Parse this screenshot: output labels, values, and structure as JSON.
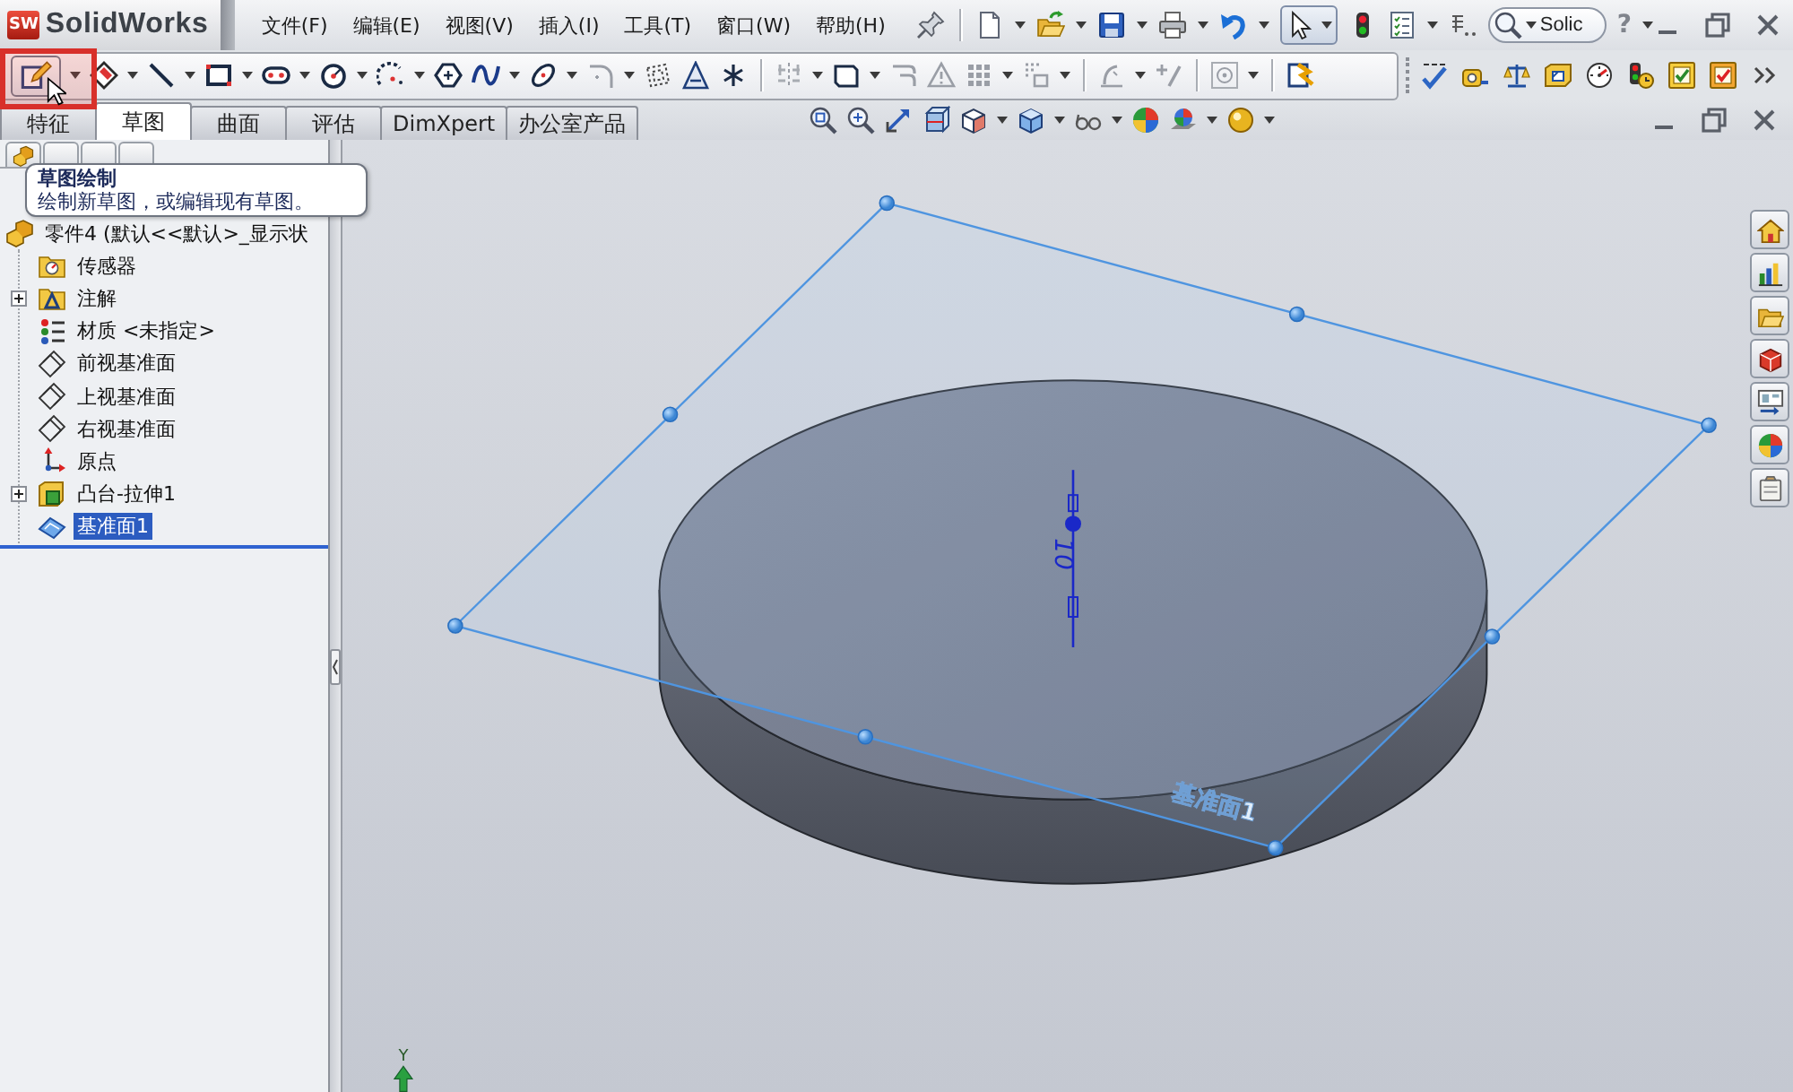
{
  "app": {
    "badge": "SW",
    "name": "SolidWorks"
  },
  "menu": [
    {
      "label": "文件(F)"
    },
    {
      "label": "编辑(E)"
    },
    {
      "label": "视图(V)"
    },
    {
      "label": "插入(I)"
    },
    {
      "label": "工具(T)"
    },
    {
      "label": "窗口(W)"
    },
    {
      "label": "帮助(H)"
    }
  ],
  "search": {
    "value": "Solic"
  },
  "help": {
    "label": "?"
  },
  "command_tabs": [
    {
      "label": "特征",
      "selected": false
    },
    {
      "label": "草图",
      "selected": true
    },
    {
      "label": "曲面",
      "selected": false
    },
    {
      "label": "评估",
      "selected": false
    },
    {
      "label": "DimXpert",
      "selected": false
    },
    {
      "label": "办公室产品",
      "selected": false
    }
  ],
  "tooltip": {
    "title": "草图绘制",
    "text": "绘制新草图，或编辑现有草图。"
  },
  "feature_tree": {
    "label": "零件4 (默认<<默认>_显示状",
    "selected": false,
    "children": [
      {
        "label": "传感器",
        "kind": "sensors",
        "collapsed": false,
        "selected": false
      },
      {
        "label": "注解",
        "kind": "annotations",
        "collapsed": true,
        "selected": false
      },
      {
        "label": "材质 <未指定>",
        "kind": "material",
        "collapsed": false,
        "selected": false
      },
      {
        "label": "前视基准面",
        "kind": "reference_plane",
        "collapsed": false,
        "selected": false
      },
      {
        "label": "上视基准面",
        "kind": "reference_plane",
        "collapsed": false,
        "selected": false
      },
      {
        "label": "右视基准面",
        "kind": "reference_plane",
        "collapsed": false,
        "selected": false
      },
      {
        "label": "原点",
        "kind": "origin",
        "collapsed": false,
        "selected": false
      },
      {
        "label": "凸台-拉伸1",
        "kind": "extrude",
        "collapsed": true,
        "selected": false
      },
      {
        "label": "基准面1",
        "kind": "plane",
        "collapsed": false,
        "selected": true
      }
    ]
  },
  "viewport": {
    "dimension": "10",
    "plane_label": "基准面1",
    "axis_label": "Y"
  }
}
